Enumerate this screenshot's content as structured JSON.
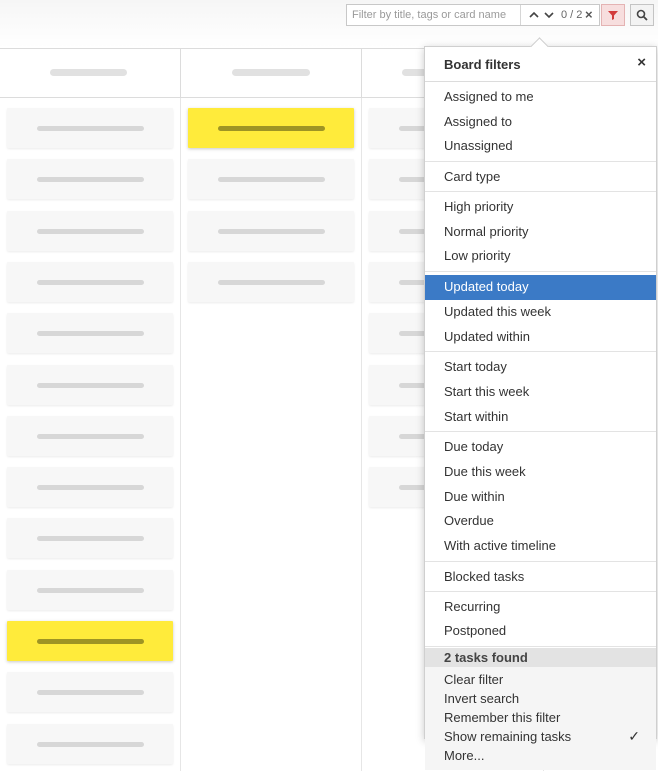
{
  "search": {
    "placeholder": "Filter by title, tags or card name",
    "value": "",
    "counter": "0 / 2"
  },
  "icons": {
    "prev": "chevron-up-icon",
    "next": "chevron-down-icon",
    "clear": "close-icon",
    "filter": "funnel-icon",
    "search": "search-icon"
  },
  "colors": {
    "highlight_card": "#ffeb3b",
    "active_item": "#3b7ac6",
    "filter_button": "#f7dede"
  },
  "board": {
    "columns": [
      {
        "cards": [
          false,
          false,
          false,
          false,
          false,
          false,
          false,
          false,
          false,
          false,
          true,
          false,
          false
        ]
      },
      {
        "cards": [
          true,
          false,
          false,
          false
        ]
      },
      {
        "cards": [
          false,
          false,
          false,
          false,
          false,
          false,
          false,
          false
        ]
      }
    ]
  },
  "filters": {
    "title": "Board filters",
    "close": "×",
    "groups": [
      {
        "items": [
          "Assigned to me",
          "Assigned to",
          "Unassigned"
        ]
      },
      {
        "items": [
          "Card type"
        ]
      },
      {
        "items": [
          "High priority",
          "Normal priority",
          "Low priority"
        ]
      },
      {
        "items": [
          "Updated today",
          "Updated this week",
          "Updated within"
        ],
        "active": "Updated today"
      },
      {
        "items": [
          "Start today",
          "Start this week",
          "Start within"
        ]
      },
      {
        "items": [
          "Due today",
          "Due this week",
          "Due within",
          "Overdue",
          "With active timeline"
        ]
      },
      {
        "items": [
          "Blocked tasks"
        ]
      },
      {
        "items": [
          "Recurring",
          "Postponed"
        ]
      }
    ],
    "found_text": "2 tasks found",
    "actions": [
      {
        "label": "Clear filter",
        "checked": false
      },
      {
        "label": "Invert search",
        "checked": false
      },
      {
        "label": "Remember this filter",
        "checked": false
      },
      {
        "label": "Show remaining tasks",
        "checked": true
      },
      {
        "label": "More...",
        "checked": false
      }
    ],
    "check_mark": "✓"
  }
}
